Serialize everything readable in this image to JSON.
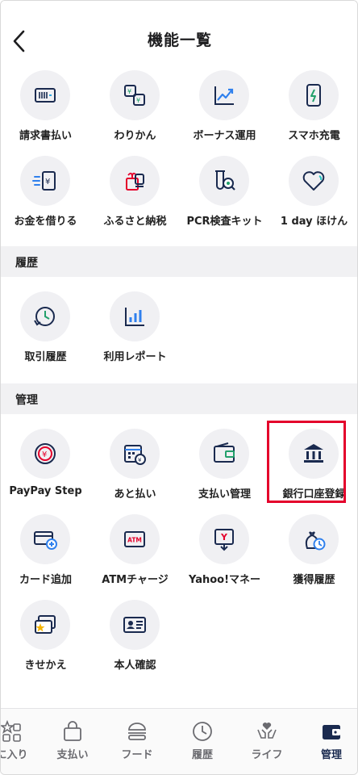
{
  "header": {
    "title": "機能一覧"
  },
  "rows": {
    "r1": [
      "請求書払い",
      "わりかん",
      "ボーナス運用",
      "スマホ充電"
    ],
    "r2": [
      "お金を借りる",
      "ふるさと納税",
      "PCR検査キット",
      "1 day ほけん"
    ]
  },
  "history": {
    "title": "履歴",
    "items": [
      "取引履歴",
      "利用レポート"
    ]
  },
  "manage": {
    "title": "管理",
    "r1": [
      "PayPay Step",
      "あと払い",
      "支払い管理",
      "銀行口座登録"
    ],
    "r2": [
      "カード追加",
      "ATMチャージ",
      "Yahoo!マネー",
      "獲得履歴"
    ],
    "r3": [
      "きせかえ",
      "本人確認"
    ]
  },
  "tabs": [
    "に入り",
    "支払い",
    "フード",
    "履歴",
    "ライフ",
    "管理"
  ],
  "icon_text": {
    "atm": "ATM"
  },
  "colors": {
    "navy": "#1a2a4f",
    "accent_red": "#e4002b",
    "icon_bg": "#f0f0f3"
  }
}
